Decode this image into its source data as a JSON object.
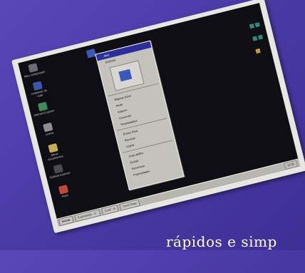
{
  "desktop": {
    "icons": [
      {
        "label": "Meu computador",
        "color": "#6a6a78"
      },
      {
        "label": "Ambiente de rede",
        "color": "#3b55a8"
      },
      {
        "label": "Internet Explorer",
        "color": "#3e8a5a"
      },
      {
        "label": "Lixeira",
        "color": "#8c8c96"
      },
      {
        "label": "Meus documentos",
        "color": "#c8b050"
      },
      {
        "label": "Outlook Express",
        "color": "#4a4a55"
      },
      {
        "label": "Paint",
        "color": "#c04a3a"
      }
    ]
  },
  "context_menu": {
    "items_top": [
      "Abrir",
      "Explorar"
    ],
    "items_mid": [
      "Mapear Drive",
      "Rede",
      "Arquivo",
      "Converter",
      "Propriedades"
    ],
    "items_send": [
      "Enviar Para",
      "Recortar",
      "Copiar"
    ],
    "items_bottom": [
      "Criar atalho",
      "Excluir",
      "Renomear",
      "Propriedades"
    ]
  },
  "taskbar": {
    "start_label": "Iniciar",
    "tasks": [
      "Explorando - C:",
      "Corel - 8",
      "Corel Draw"
    ],
    "clock": "12:00"
  },
  "caption": {
    "text": "rápidos e simp"
  },
  "colors": {
    "background": "#4a3aa6",
    "menu_highlight": "#2c2c9c"
  }
}
